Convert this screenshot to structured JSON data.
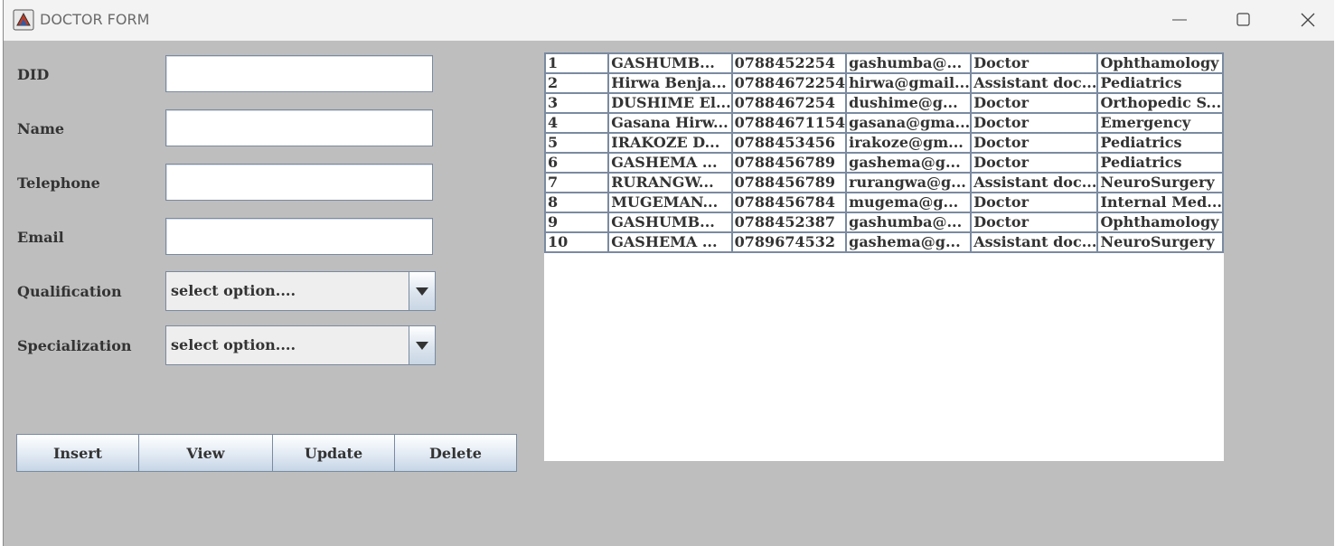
{
  "window": {
    "title": "DOCTOR FORM"
  },
  "form": {
    "did_label": "DID",
    "name_label": "Name",
    "telephone_label": "Telephone",
    "email_label": "Email",
    "qualification_label": "Qualification",
    "specialization_label": "Specialization",
    "did_value": "",
    "name_value": "",
    "telephone_value": "",
    "email_value": "",
    "qualification_selected": "select option....",
    "specialization_selected": "select option...."
  },
  "buttons": {
    "insert": "Insert",
    "view": "View",
    "update": "Update",
    "delete": "Delete"
  },
  "table": {
    "rows": [
      [
        "1",
        "GASHUMB...",
        "0788452254",
        "gashumba@...",
        "Doctor",
        "Ophthamology"
      ],
      [
        "2",
        "Hirwa Benja...",
        "07884672254",
        "hirwa@gmail...",
        "Assistant doc...",
        "Pediatrics"
      ],
      [
        "3",
        "DUSHIME El...",
        "0788467254",
        "dushime@g...",
        "Doctor",
        "Orthopedic S..."
      ],
      [
        "4",
        "Gasana Hirw...",
        "07884671154",
        "gasana@gma...",
        "Doctor",
        "Emergency"
      ],
      [
        "5",
        "IRAKOZE D...",
        "0788453456",
        "irakoze@gm...",
        "Doctor",
        "Pediatrics"
      ],
      [
        "6",
        "GASHEMA ...",
        "0788456789",
        "gashema@g...",
        "Doctor",
        "Pediatrics"
      ],
      [
        "7",
        "RURANGW...",
        "0788456789",
        "rurangwa@g...",
        "Assistant doc...",
        "NeuroSurgery"
      ],
      [
        "8",
        "MUGEMAN...",
        "0788456784",
        "mugema@g...",
        "Doctor",
        "Internal Med..."
      ],
      [
        "9",
        "GASHUMB...",
        "0788452387",
        "gashumba@...",
        "Doctor",
        "Ophthamology"
      ],
      [
        "10",
        "GASHEMA ...",
        "0789674532",
        "gashema@g...",
        "Assistant doc...",
        "NeuroSurgery"
      ]
    ]
  },
  "icons": {
    "app": "java-app-icon",
    "minimize": "minimize-icon",
    "maximize": "maximize-icon",
    "close": "close-icon",
    "dropdown": "chevron-down-icon"
  }
}
